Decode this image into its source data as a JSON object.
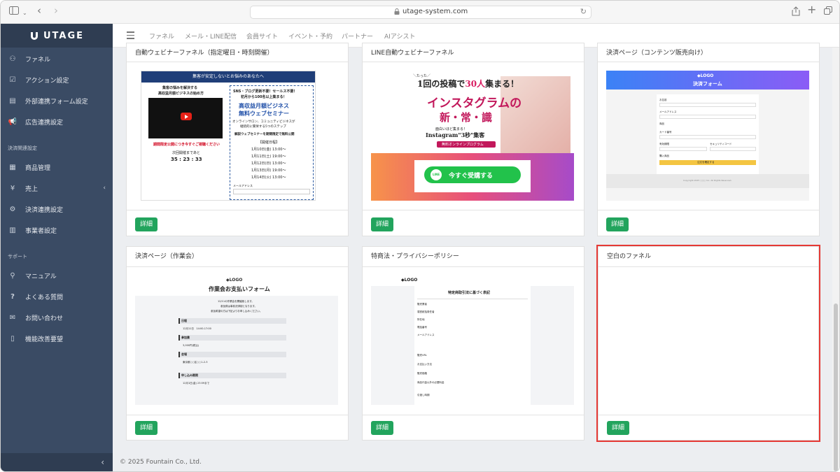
{
  "browser": {
    "url": "utage-system.com"
  },
  "sidebar": {
    "brand": "UTAGE",
    "items": [
      {
        "label": "ファネル",
        "icon": "funnel-icon"
      },
      {
        "label": "アクション設定",
        "icon": "action-icon"
      },
      {
        "label": "外部連携フォーム設定",
        "icon": "form-icon"
      },
      {
        "label": "広告連携設定",
        "icon": "megaphone-icon"
      }
    ],
    "section_payment": "決済関連設定",
    "payment_items": [
      {
        "label": "商品管理",
        "icon": "product-icon"
      },
      {
        "label": "売上",
        "icon": "yen-icon"
      },
      {
        "label": "決済連携設定",
        "icon": "gear-icon"
      },
      {
        "label": "事業者設定",
        "icon": "building-icon"
      }
    ],
    "section_support": "サポート",
    "support_items": [
      {
        "label": "マニュアル",
        "icon": "manual-icon"
      },
      {
        "label": "よくある質問",
        "icon": "question-icon"
      },
      {
        "label": "お問い合わせ",
        "icon": "chat-icon"
      },
      {
        "label": "機能改善要望",
        "icon": "document-icon"
      }
    ]
  },
  "topnav": {
    "items": [
      "ファネル",
      "メール・LINE配信",
      "会員サイト",
      "イベント・予約",
      "パートナー",
      "AIアシスト"
    ]
  },
  "cards": [
    {
      "title": "自動ウェビナーファネル（指定曜日・時刻開催）",
      "button": "詳細"
    },
    {
      "title": "LINE自動ウェビナーファネル",
      "button": "詳細"
    },
    {
      "title": "決済ページ（コンテンツ販売向け）",
      "button": "詳細"
    },
    {
      "title": "決済ページ（作業会）",
      "button": "詳細"
    },
    {
      "title": "特商法・プライバシーポリシー",
      "button": "詳細"
    },
    {
      "title": "空白のファネル",
      "button": "詳細"
    }
  ],
  "thumb1": {
    "header": "集客が安定しないとお悩みのあなたへ",
    "left1": "集客の悩みを解決する",
    "left2": "高収益月額ビジネスの始め方",
    "left_red": "期間限定公開につき今すぐご視聴ください",
    "countdown_label": "次回開催まであと",
    "countdown": "35 : 23 : 33",
    "r1": "SNS・ブログ更新不要！セールス不要！",
    "r2": "初月から100名以上集まる！",
    "r3": "高収益月額ビジネス",
    "r4": "無料ウェブセミナー",
    "r5": "オンラインサロン、コミュニティビジネスが",
    "r6": "継続的に繁栄する5つのステップ",
    "r7": "解説ウェブセミナーを期間限定で無料公開",
    "schedule_title": "【開催日程】",
    "dates": [
      "1月10日(金) 13:00〜",
      "1月11日(土) 19:00〜",
      "1月12日(日) 13:00〜",
      "1月13日(月) 19:00〜",
      "1月14日(火) 13:00〜"
    ],
    "mail_label": "メールアドレス"
  },
  "thumb2": {
    "line1": "＼たった／",
    "line2a": "1回の投稿で",
    "line2b": "30人",
    "line2c": "集まる！",
    "line3": "インスタグラムの",
    "line4": "新・常・識",
    "line5": "面白いほど集まる！",
    "line6": "Instagram\"3秒\"集客",
    "badge": "無料オンラインプログラム",
    "cta": "今すぐ受講する",
    "line_badge": "LINE"
  },
  "thumb3": {
    "logo": "◆LOGO",
    "heading": "決済フォーム",
    "fields": [
      "お名前",
      "メールアドレス",
      "商品",
      "カード番号",
      "有効期限",
      "セキュリティコード",
      "購入商品"
    ],
    "submit": "注文を確定する",
    "footer": "Copyright 2025 ○○○ Inc. All Rights Reserved."
  },
  "thumb4": {
    "logo": "◆LOGO",
    "heading": "作業会お支払いフォーム",
    "intro1": "12/11の作業会を開催致します。",
    "intro2": "参加費は事前決済制となります。",
    "intro3": "参加希望の方は下記よりお申し込みください。",
    "sections": [
      {
        "h": "日程",
        "body": "12月11日　14:00-17:00"
      },
      {
        "h": "参加費",
        "body": "3,000円(税込)"
      },
      {
        "h": "会場",
        "body": "東京都○○区○○1-2-3"
      },
      {
        "h": "申し込み期限",
        "body": "12月1日(金) 23:59まで"
      }
    ]
  },
  "thumb5": {
    "logo": "◆LOGO",
    "heading": "特定商取引法に基づく表記",
    "rows": [
      "販売業者",
      "運営統括責任者",
      "所在地",
      "電話番号",
      "メールアドレス",
      "販売URL",
      "お支払い方法",
      "販売価格",
      "商品代金以外の必要料金",
      "引渡し時期"
    ]
  },
  "footer": "© 2025 Fountain Co., Ltd."
}
